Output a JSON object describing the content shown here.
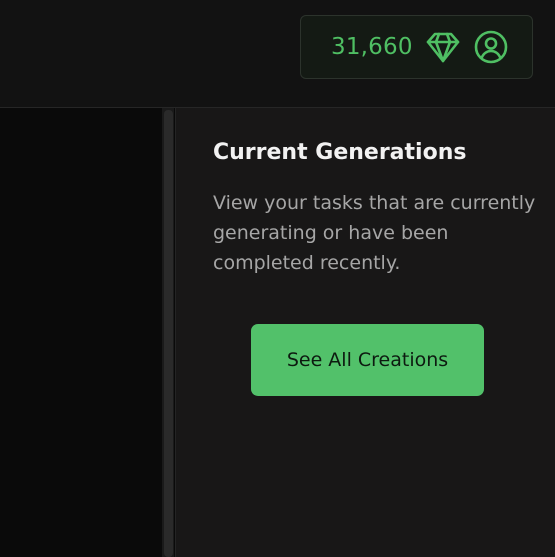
{
  "header": {
    "credits": "31,660",
    "credits_icon": "gem-icon",
    "account_icon": "user-circle-icon",
    "accent_color": "#4fbf63"
  },
  "panel": {
    "title": "Current Generations",
    "description": "View your tasks that are currently generating or have been completed recently.",
    "button_label": "See All Creations",
    "button_color": "#52c16a"
  }
}
